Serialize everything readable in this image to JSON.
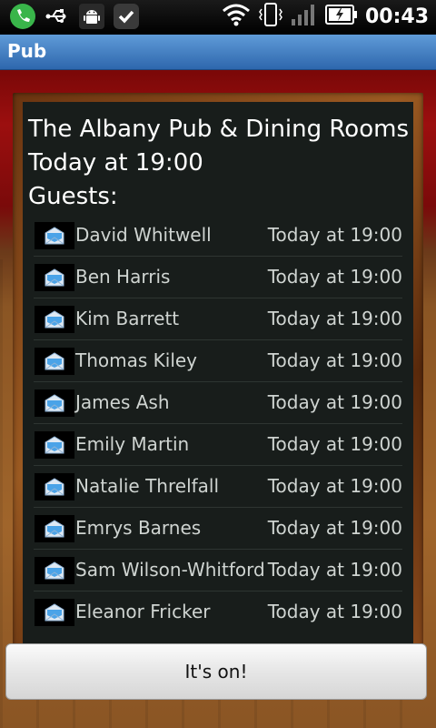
{
  "statusbar": {
    "time": "00:43",
    "left_icons": [
      "phone-icon",
      "usb-icon",
      "android-debug-icon",
      "check-icon"
    ],
    "right_icons": [
      "wifi-icon",
      "vibrate-icon",
      "signal-icon",
      "battery-charging-icon"
    ]
  },
  "titlebar": {
    "title": "Pub"
  },
  "board": {
    "venue": "The Albany Pub & Dining Rooms",
    "when": "Today at 19:00",
    "guests_label": "Guests:",
    "guests": [
      {
        "name": "David Whitwell",
        "time": "Today at 19:00"
      },
      {
        "name": "Ben Harris",
        "time": "Today at 19:00"
      },
      {
        "name": "Kim Barrett",
        "time": "Today at 19:00"
      },
      {
        "name": "Thomas Kiley",
        "time": "Today at 19:00"
      },
      {
        "name": "James Ash",
        "time": "Today at 19:00"
      },
      {
        "name": "Emily Martin",
        "time": "Today at 19:00"
      },
      {
        "name": "Natalie Threlfall",
        "time": "Today at 19:00"
      },
      {
        "name": "Emrys Barnes",
        "time": "Today at 19:00"
      },
      {
        "name": "Sam Wilson-Whitford",
        "time": "Today at 19:00"
      },
      {
        "name": "Eleanor Fricker",
        "time": "Today at 19:00"
      }
    ]
  },
  "action": {
    "label": "It's on!"
  },
  "colors": {
    "titlebar": "#3a76bd",
    "board": "#181d1b",
    "text": "#cfd4d1"
  }
}
